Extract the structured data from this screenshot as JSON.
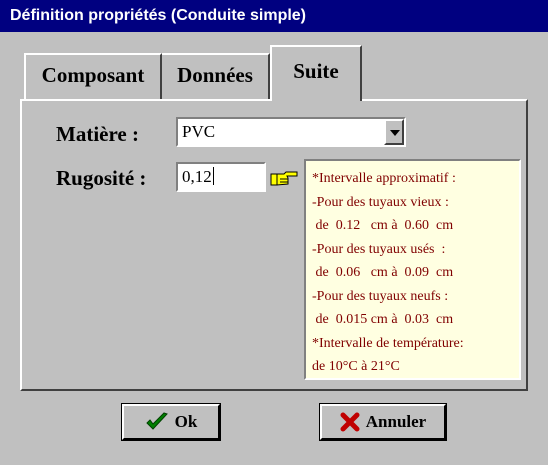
{
  "window": {
    "title": "Définition propriétés (Conduite simple)"
  },
  "tabs": [
    {
      "label": "Composant",
      "active": false
    },
    {
      "label": "Données",
      "active": false
    },
    {
      "label": "Suite",
      "active": true
    }
  ],
  "form": {
    "matiere_label": "Matière  :",
    "matiere_value": "PVC",
    "rugosite_label": "Rugosité :",
    "rugosite_value": "0,12",
    "hint_icon": "pointing-hand-icon"
  },
  "info": {
    "lines": [
      "*Intervalle approximatif :",
      "-Pour des tuyaux vieux :",
      " de  0.12   cm à  0.60  cm",
      "-Pour des tuyaux usés  :",
      " de  0.06   cm à  0.09  cm",
      "-Pour des tuyaux neufs :",
      " de  0.015 cm à  0.03  cm",
      "*Intervalle de température:",
      "de 10°C à 21°C"
    ]
  },
  "buttons": {
    "ok_label": "Ok",
    "ok_icon": "checkmark-icon",
    "cancel_label": "Annuler",
    "cancel_icon": "red-x-icon"
  },
  "colors": {
    "titlebar": "#000080",
    "info_background": "#ffffe1",
    "info_text": "#800000",
    "ok_check": "#008000",
    "cancel_x": "#c00000"
  }
}
